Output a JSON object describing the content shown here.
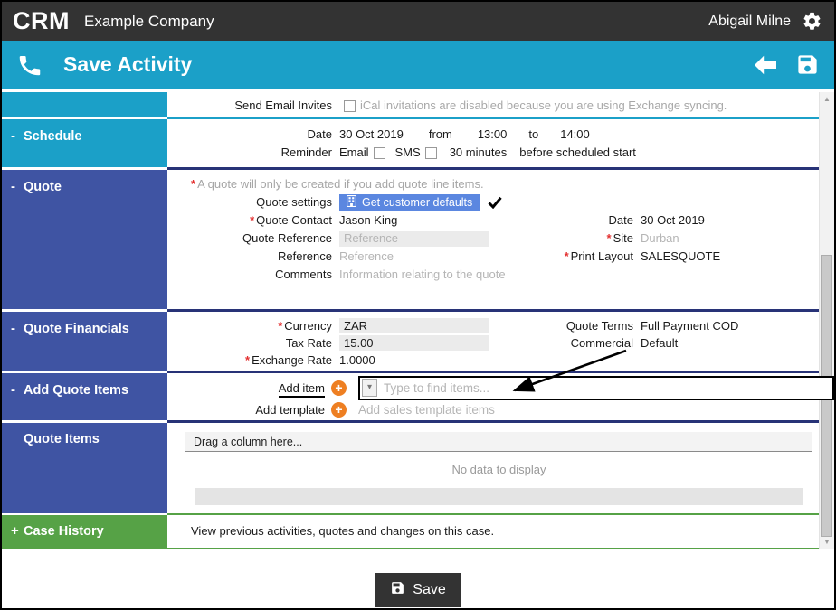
{
  "misc": {
    "required_marker": "*"
  },
  "colors": {
    "topbar": "#333333",
    "cyan": "#1ba0c8",
    "indigo": "#3f54a3",
    "green": "#56a246",
    "navy_divider": "#283377",
    "orange": "#ee7f22",
    "button_blue": "#5b87e0",
    "red_required": "#e33030"
  },
  "icons": {
    "scroll_up": "▲",
    "scroll_down": "▼",
    "dropdown": "▾",
    "plus": "+"
  },
  "topbar": {
    "logo": "CRM",
    "company": "Example Company",
    "user": "Abigail Milne"
  },
  "header": {
    "title": "Save Activity"
  },
  "sidebar": {
    "sections": [
      {
        "toggle": "",
        "label": ""
      },
      {
        "toggle": "-",
        "label": "Schedule"
      },
      {
        "toggle": "-",
        "label": "Quote"
      },
      {
        "toggle": "-",
        "label": "Quote Financials"
      },
      {
        "toggle": "-",
        "label": "Add Quote Items"
      },
      {
        "toggle": "",
        "label": "Quote Items"
      },
      {
        "toggle": "+",
        "label": "Case History"
      }
    ]
  },
  "invites": {
    "label": "Send Email Invites",
    "note": "iCal invitations are disabled because you are using Exchange syncing."
  },
  "schedule": {
    "date_label": "Date",
    "date": "30 Oct 2019",
    "from_label": "from",
    "from_time": "13:00",
    "to_label": "to",
    "to_time": "14:00",
    "reminder_label": "Reminder",
    "email_label": "Email",
    "sms_label": "SMS",
    "minutes": "30 minutes",
    "suffix": "before scheduled start"
  },
  "quote": {
    "note": "A quote will only be created if you add quote line items.",
    "settings_label": "Quote settings",
    "settings_button": "Get customer defaults",
    "contact_label": "Quote Contact",
    "contact_value": "Jason King",
    "date_label": "Date",
    "date_value": "30 Oct 2019",
    "quote_reference_label": "Quote Reference",
    "quote_reference_placeholder": "Reference",
    "site_label": "Site",
    "site_value": "Durban",
    "reference_label": "Reference",
    "reference_placeholder": "Reference",
    "print_layout_label": "Print Layout",
    "print_layout_value": "SALESQUOTE",
    "comments_label": "Comments",
    "comments_placeholder": "Information relating to the quote"
  },
  "financials": {
    "currency_label": "Currency",
    "currency_value": "ZAR",
    "tax_label": "Tax Rate",
    "tax_value": "15.00",
    "exchange_label": "Exchange Rate",
    "exchange_value": "1.0000",
    "terms_label": "Quote Terms",
    "terms_value": "Full Payment COD",
    "commercial_label": "Commercial",
    "commercial_value": "Default"
  },
  "add_items": {
    "add_item_label": "Add item",
    "find_placeholder": "Type to find items...",
    "add_template_label": "Add template",
    "template_hint": "Add sales template items"
  },
  "quote_items": {
    "drag_hint": "Drag a column here...",
    "empty_text": "No data to display"
  },
  "case_history": {
    "text": "View previous activities, quotes and changes on this case."
  },
  "footer": {
    "save_label": "Save"
  }
}
